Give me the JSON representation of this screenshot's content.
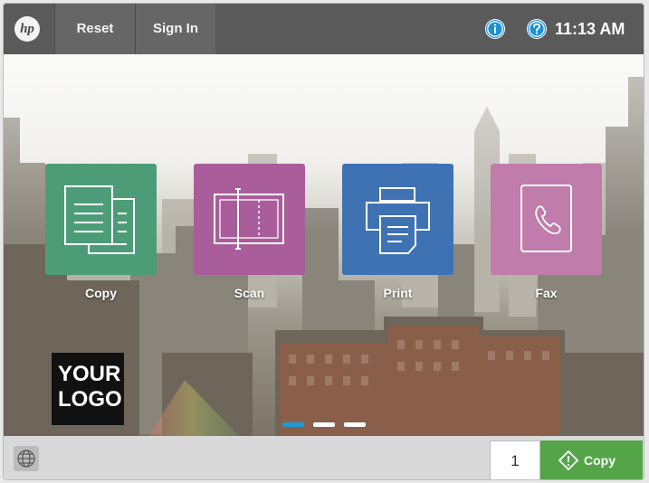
{
  "header": {
    "brand": "hp",
    "reset_label": "Reset",
    "signin_label": "Sign In",
    "time": "11:13 AM"
  },
  "apps": [
    {
      "label": "Copy",
      "icon": "copy-icon",
      "color": "#4c9d77"
    },
    {
      "label": "Scan",
      "icon": "scan-icon",
      "color": "#a95d9a"
    },
    {
      "label": "Print",
      "icon": "print-icon",
      "color": "#3e72b3"
    },
    {
      "label": "Fax",
      "icon": "fax-icon",
      "color": "#c07cab"
    }
  ],
  "logo": {
    "line1": "YOUR",
    "line2": "LOGO"
  },
  "pagination": {
    "pages": 3,
    "active": 1,
    "active_color": "#1e9ad6"
  },
  "footer": {
    "copies_count": "1",
    "copy_label": "Copy",
    "accent": "#54a548"
  }
}
